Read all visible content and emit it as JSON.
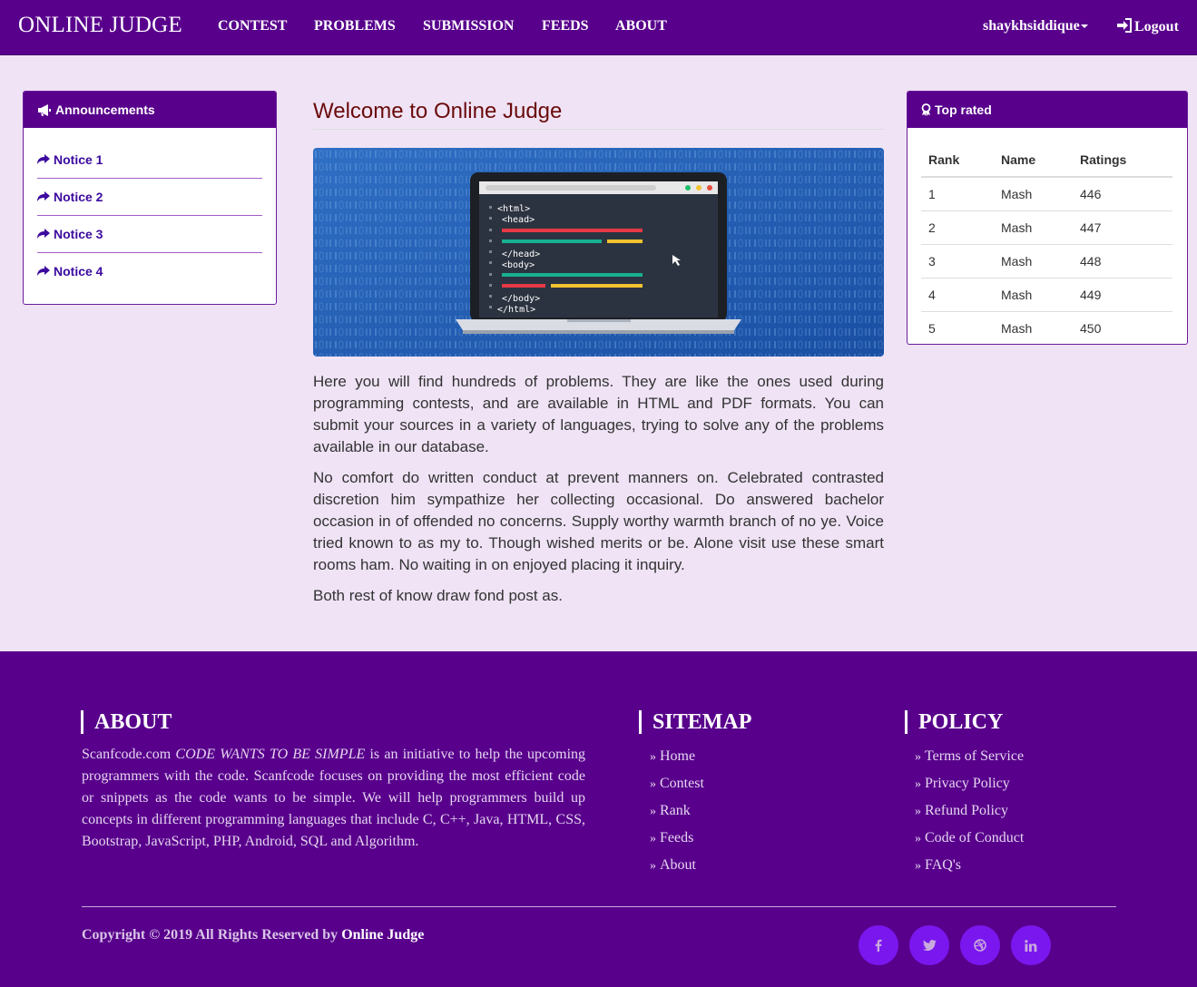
{
  "navbar": {
    "brand": "ONLINE JUDGE",
    "items": [
      "CONTEST",
      "PROBLEMS",
      "SUBMISSION",
      "FEEDS",
      "ABOUT"
    ],
    "username": "shaykhsiddique",
    "logout_label": "Logout"
  },
  "announcements": {
    "title": "Announcements",
    "items": [
      "Notice 1",
      "Notice 2",
      "Notice 3",
      "Notice 4"
    ]
  },
  "main": {
    "title": "Welcome to Online Judge",
    "paragraphs": [
      "Here you will find hundreds of problems. They are like the ones used during programming contests, and are available in HTML and PDF formats. You can submit your sources in a variety of languages, trying to solve any of the problems available in our database.",
      "No comfort do written conduct at prevent manners on. Celebrated contrasted discretion him sympathize her collecting occasional. Do answered bachelor occasion in of offended no concerns. Supply worthy warmth branch of no ye. Voice tried known to as my to. Though wished merits or be. Alone visit use these smart rooms ham. No waiting in on enjoyed placing it inquiry.",
      "Both rest of know draw fond post as."
    ],
    "code_lines": [
      "<html>",
      "<head>",
      "</head>",
      "<body>",
      "</body>",
      "</html>"
    ]
  },
  "top_rated": {
    "title": "Top rated",
    "headers": [
      "Rank",
      "Name",
      "Ratings"
    ],
    "rows": [
      [
        "1",
        "Mash",
        "446"
      ],
      [
        "2",
        "Mash",
        "447"
      ],
      [
        "3",
        "Mash",
        "448"
      ],
      [
        "4",
        "Mash",
        "449"
      ],
      [
        "5",
        "Mash",
        "450"
      ]
    ]
  },
  "footer": {
    "about_title": "ABOUT",
    "about_site": "Scanfcode.com",
    "about_tagline": "CODE WANTS TO BE SIMPLE",
    "about_rest": "is an initiative to help the upcoming programmers with the code. Scanfcode focuses on providing the most efficient code or snippets as the code wants to be simple. We will help programmers build up concepts in different programming languages that include C, C++, Java, HTML, CSS, Bootstrap, JavaScript, PHP, Android, SQL and Algorithm.",
    "sitemap_title": "SITEMAP",
    "sitemap": [
      "Home",
      "Contest",
      "Rank",
      "Feeds",
      "About"
    ],
    "policy_title": "POLICY",
    "policy": [
      "Terms of Service",
      "Privacy Policy",
      "Refund Policy",
      "Code of Conduct",
      "FAQ's"
    ],
    "copyright": "Copyright © 2019 All Rights Reserved by",
    "copyright_brand": "Online Judge",
    "social": [
      "facebook-icon",
      "twitter-icon",
      "dribbble-icon",
      "linkedin-icon"
    ]
  },
  "colors": {
    "primary": "#58008c",
    "page_bg": "#efe3f5",
    "link": "#3c0a9e",
    "heading": "#6a0a0a",
    "social_bg": "#7a17ef"
  }
}
